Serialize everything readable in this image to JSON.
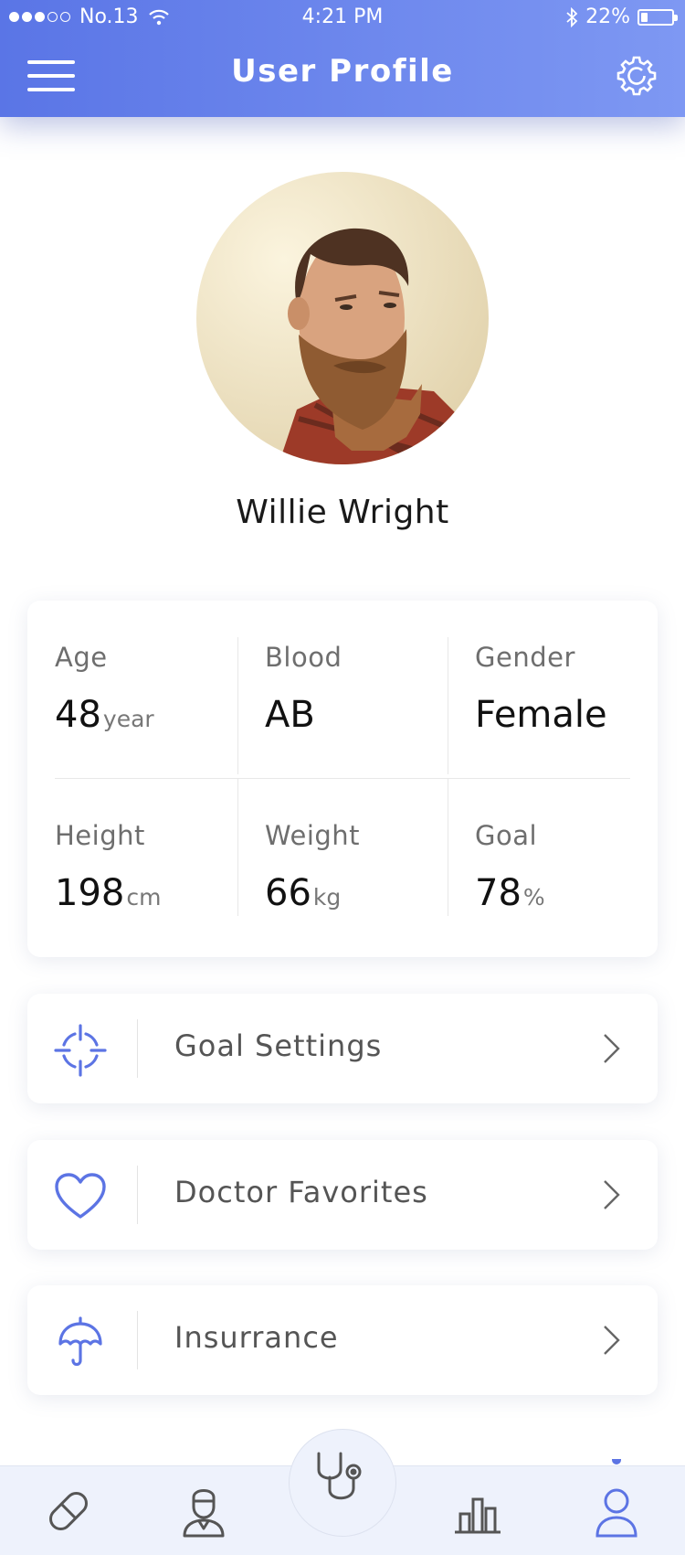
{
  "status_bar": {
    "carrier": "No.13",
    "time": "4:21 PM",
    "battery_percent": "22%",
    "battery_level": 0.22,
    "signal_bars_filled": 3,
    "signal_bars_total": 5
  },
  "header": {
    "title": "User Profile",
    "menu_icon": "hamburger-menu-icon",
    "settings_icon": "gear-icon"
  },
  "profile": {
    "name": "Willie Wright"
  },
  "stats": [
    {
      "label": "Age",
      "value": "48",
      "unit": "year"
    },
    {
      "label": "Blood",
      "value": "AB",
      "unit": ""
    },
    {
      "label": "Gender",
      "value": "Female",
      "unit": ""
    },
    {
      "label": "Height",
      "value": "198",
      "unit": "cm"
    },
    {
      "label": "Weight",
      "value": "66",
      "unit": "kg"
    },
    {
      "label": "Goal",
      "value": "78",
      "unit": "%"
    }
  ],
  "menu": [
    {
      "label": "Goal Settings",
      "icon": "crosshair-target-icon"
    },
    {
      "label": "Doctor Favorites",
      "icon": "heart-icon"
    },
    {
      "label": "Insurrance",
      "icon": "umbrella-icon"
    }
  ],
  "tabbar": {
    "tabs": [
      "pill-icon",
      "doctor-icon",
      "stethoscope-icon",
      "bar-chart-icon",
      "user-icon"
    ],
    "active": "user-icon"
  },
  "colors": {
    "accent": "#5c74e4",
    "header_start": "#5a75e6",
    "header_end": "#7e98f3",
    "tabbar_bg": "#eef2fc",
    "tab_icon": "#555555"
  }
}
